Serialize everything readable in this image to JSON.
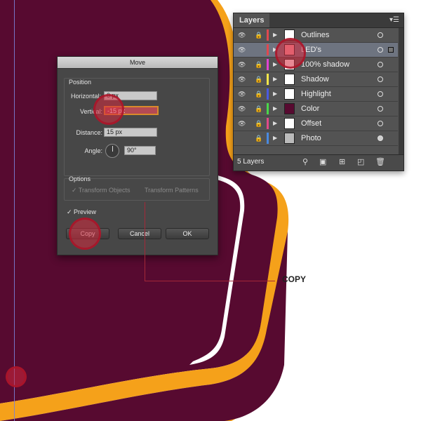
{
  "colors": {
    "maroon": "#570a30",
    "orange": "#f5a11a",
    "highlight": "#d6283c",
    "guide": "#7b7fd6"
  },
  "move_dialog": {
    "title": "Move",
    "position_label": "Position",
    "horizontal_label": "Horizontal:",
    "horizontal_value": "0 px",
    "vertical_label": "Vertical:",
    "vertical_value": "-15 px",
    "distance_label": "Distance:",
    "distance_value": "15 px",
    "angle_label": "Angle:",
    "angle_value": "90°",
    "options_label": "Options",
    "transform_objects": "✓ Transform Objects",
    "transform_patterns": "Transform Patterns",
    "preview": "✓ Preview",
    "copy_button": "Copy",
    "cancel_button": "Cancel",
    "ok_button": "OK"
  },
  "layers_panel": {
    "tab_title": "Layers",
    "menu_icon": "panel-menu-icon",
    "count": "5 Layers",
    "layers": [
      {
        "name": "Outlines",
        "color": "#e0484f",
        "visible": true,
        "locked": true,
        "thumb": "white"
      },
      {
        "name": "LED's",
        "color": "#e0484f",
        "visible": true,
        "locked": false,
        "thumb": "pink",
        "selected": true
      },
      {
        "name": "100% shadow",
        "color": "#e043d2",
        "visible": true,
        "locked": true,
        "thumb": "white"
      },
      {
        "name": "Shadow",
        "color": "#f2e64a",
        "visible": true,
        "locked": true,
        "thumb": "white"
      },
      {
        "name": "Highlight",
        "color": "#4a5ae0",
        "visible": true,
        "locked": true,
        "thumb": "white"
      },
      {
        "name": "Color",
        "color": "#4ad84a",
        "visible": true,
        "locked": true,
        "thumb": "maroon"
      },
      {
        "name": "Offset",
        "color": "#e04a8a",
        "visible": true,
        "locked": true,
        "thumb": "white"
      },
      {
        "name": "Photo",
        "color": "#4a8ae0",
        "visible": false,
        "locked": true,
        "thumb": "photo"
      }
    ]
  },
  "callout": {
    "text": "COPY"
  }
}
